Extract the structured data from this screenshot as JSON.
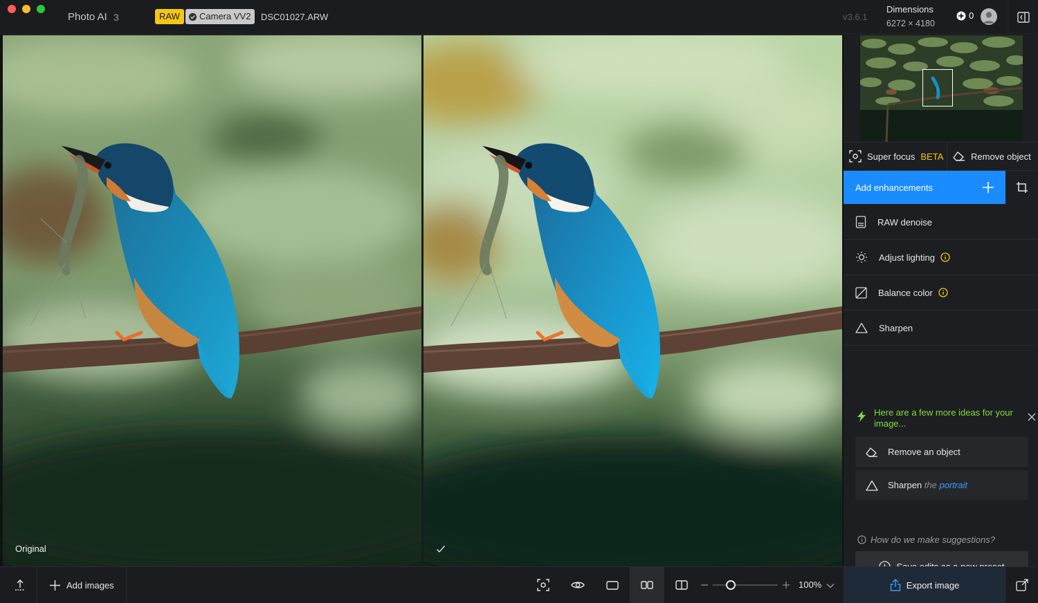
{
  "app": {
    "title": "Photo AI",
    "version_number": "3",
    "build": "v3.6.1"
  },
  "file": {
    "raw_badge": "RAW",
    "camera_badge": "Camera VV2",
    "filename": "DSC01027.ARW"
  },
  "dimensions": {
    "label": "Dimensions",
    "value": "6272 × 4180"
  },
  "credits": {
    "count": "0"
  },
  "panes": {
    "left_label": "Original"
  },
  "tools": {
    "super_focus": "Super focus",
    "super_focus_tag": "BETA",
    "remove_object": "Remove object"
  },
  "enhancements": {
    "add_label": "Add enhancements",
    "items": [
      {
        "label": "RAW denoise",
        "icon": "raw-denoise-icon",
        "info": false
      },
      {
        "label": "Adjust lighting",
        "icon": "sun-icon",
        "info": true
      },
      {
        "label": "Balance color",
        "icon": "balance-color-icon",
        "info": true
      },
      {
        "label": "Sharpen",
        "icon": "triangle-icon",
        "info": false
      }
    ]
  },
  "ideas": {
    "heading": "Here are a few more ideas for your image...",
    "suggestions": [
      {
        "label": "Remove an object"
      },
      {
        "label": "Sharpen",
        "muted": "the",
        "accent": "portrait"
      }
    ],
    "how_link": "How do we make suggestions?",
    "preset_button": "Save edits as a new preset"
  },
  "bottom": {
    "add_images": "Add images",
    "zoom": "100%",
    "zoom_level": 0.28,
    "export": "Export image"
  },
  "colors": {
    "accent_blue": "#1a8cff",
    "raw_badge": "#f5c518",
    "ideas_green": "#7cdc3c",
    "info_yellow": "#f5c518"
  }
}
